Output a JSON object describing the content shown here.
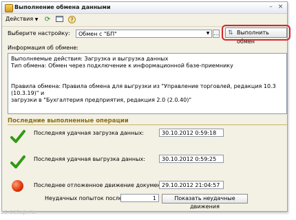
{
  "window": {
    "title": "Выполнение обмена данными",
    "buttons": {
      "minimize": "–",
      "close": "×"
    }
  },
  "toolbar": {
    "actions_label": "Действия",
    "icons": [
      "refresh-icon",
      "window-icon",
      "help-icon"
    ]
  },
  "settings": {
    "label": "Выберите настройку:",
    "value": "Обмен с \"БП\"",
    "run_button": "Выполнить обмен"
  },
  "info": {
    "label": "Информация об обмене:",
    "lines": [
      "Выполняемые действия: Загрузка и выгрузка данных",
      "Тип обмена:  Обмен через подключение к информационной базе-приемнику",
      "Правила обмена: Правила обмена для выгрузки из \"Управление торговлей, редакция 10.3 (10.3.19)\" и",
      "загрузки в \"Бухгалтерия предприятия, редакция 2.0 (2.0.40)\""
    ]
  },
  "operations": {
    "section_title": "Последние выполненные операции",
    "last_load_label": "Последняя удачная загрузка данных:",
    "last_load_value": "30.10.2012   0:59:18",
    "last_unload_label": "Последняя удачная выгрузка данных:",
    "last_unload_value": "30.10.2012   0:59:25",
    "deferred_label": "Последнее отложенное движение документов:",
    "deferred_value": "29.10.2012 21:04:57",
    "failed_label": "Неудачных попыток после:",
    "failed_value": "1",
    "show_failed_button": "Показать неудачные движения"
  },
  "watermark": "1c-setup.ru",
  "colors": {
    "section": "#8a6d12",
    "highlight": "#d6252c",
    "check": "#2f9a12"
  }
}
